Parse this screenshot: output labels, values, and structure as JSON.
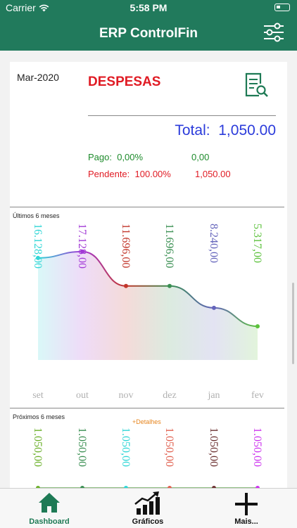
{
  "status_bar": {
    "carrier": "Carrier",
    "time": "5:58 PM"
  },
  "header": {
    "title": "ERP ControlFin",
    "filter_icon": "sliders-icon"
  },
  "summary": {
    "month": "Mar-2020",
    "title": "DESPESAS",
    "total_label": "Total:",
    "total_value": "1,050.00",
    "pago_label": "Pago:",
    "pago_pct": "0,00%",
    "pago_value": "0,00",
    "pendente_label": "Pendente:",
    "pendente_pct": "100.00%",
    "pendente_value": "1,050.00",
    "colors": {
      "title": "#e01b24",
      "total": "#2b3bdb",
      "pago": "#1e8b2c",
      "pendente": "#e01b24"
    }
  },
  "past": {
    "label": "Últimos 6 meses"
  },
  "next": {
    "label": "Próximos 6 meses",
    "details_link": "+Detalhes"
  },
  "chart_data": [
    {
      "type": "area",
      "title": "Últimos 6 meses",
      "categories": [
        "set",
        "out",
        "nov",
        "dez",
        "jan",
        "fev"
      ],
      "data_labels": [
        "16.128,00",
        "17.128,00",
        "11.696,00",
        "11.696,00",
        "8.240,00",
        "5.317,00"
      ],
      "values": [
        16128,
        17128,
        11696,
        11696,
        8240,
        5317
      ],
      "point_colors": [
        "#2fd6d6",
        "#a23ad6",
        "#c2362b",
        "#3a8f52",
        "#6464bb",
        "#5cc23c"
      ],
      "ylim": [
        0,
        18000
      ]
    },
    {
      "type": "line",
      "title": "Próximos 6 meses",
      "data_labels": [
        "1.050,00",
        "1.050,00",
        "1.050,00",
        "1.050,00",
        "1.050,00",
        "1.050,00"
      ],
      "values": [
        1050,
        1050,
        1050,
        1050,
        1050,
        1050
      ],
      "point_colors": [
        "#6bb02a",
        "#3a8f52",
        "#2fd6d6",
        "#e0604f",
        "#6b3030",
        "#cc33ee"
      ]
    }
  ],
  "tabs": [
    {
      "label": "Dashboard",
      "icon": "house-icon",
      "active": true
    },
    {
      "label": "Gráficos",
      "icon": "growth-chart-icon",
      "active": false
    },
    {
      "label": "Mais...",
      "icon": "plus-icon",
      "active": false
    }
  ]
}
